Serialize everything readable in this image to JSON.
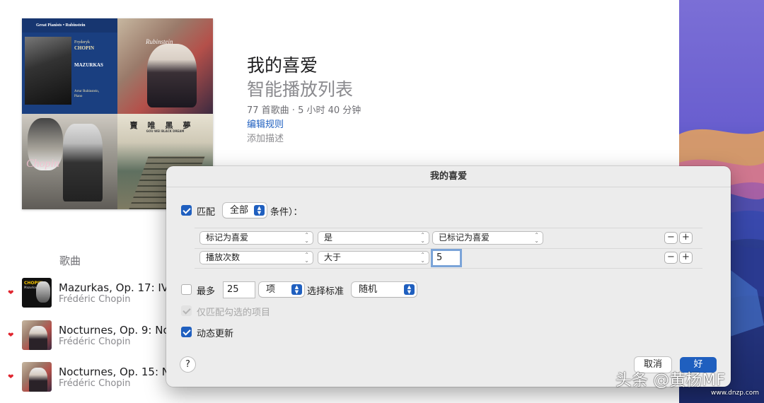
{
  "playlist": {
    "title": "我的喜爱",
    "subtitle": "智能播放列表",
    "meta": "77 首歌曲 · 5 小时 40 分钟",
    "edit_rules": "编辑规则",
    "add_description": "添加描述"
  },
  "artwork": {
    "t1_band": "Great Pianists • Rubinstein",
    "t1_name1": "Fryderyk",
    "t1_name2": "CHOPIN",
    "t1_mazurkas": "MAZURKAS",
    "t1_artist": "Artur Rubinstein,",
    "t1_piano": "Piano",
    "t2_title": "Rubinstein",
    "t3_chopin": "Chopin",
    "t4_cn": "賣唯黑夢",
    "t4_en": "GOU WEI BLACK DREAM"
  },
  "songs_header": "歌曲",
  "songs": [
    {
      "name": "Mazurkas, Op. 17: IV.",
      "artist": "Frédéric Chopin",
      "thumb_c": "CHOPIN",
      "thumb_m": "Mazurkas"
    },
    {
      "name": "Nocturnes, Op. 9: No",
      "artist": "Frédéric Chopin"
    },
    {
      "name": "Nocturnes, Op. 15: N",
      "artist": "Frédéric Chopin"
    }
  ],
  "dialog": {
    "title": "我的喜爱",
    "match_label": "匹配",
    "match_value": "全部",
    "match_suffix": "条件）：",
    "rules": [
      {
        "field": "标记为喜爱",
        "op": "是",
        "value": "已标记为喜爱"
      },
      {
        "field": "播放次数",
        "op": "大于",
        "value": "5"
      }
    ],
    "minus": "−",
    "plus": "+",
    "limit_label": "最多",
    "limit_value": "25",
    "limit_unit": "项",
    "selected_by_label": "选择标准",
    "selected_by_value": "随机",
    "checked_only": "仅匹配勾选的项目",
    "live_update": "动态更新",
    "help": "?",
    "cancel": "取消",
    "ok": "好"
  },
  "watermark": "头条 @黄杨MF",
  "watermark_url": "www.dnzp.com",
  "colors": {
    "accent": "#1f5fbf",
    "heart": "#e0242e"
  }
}
